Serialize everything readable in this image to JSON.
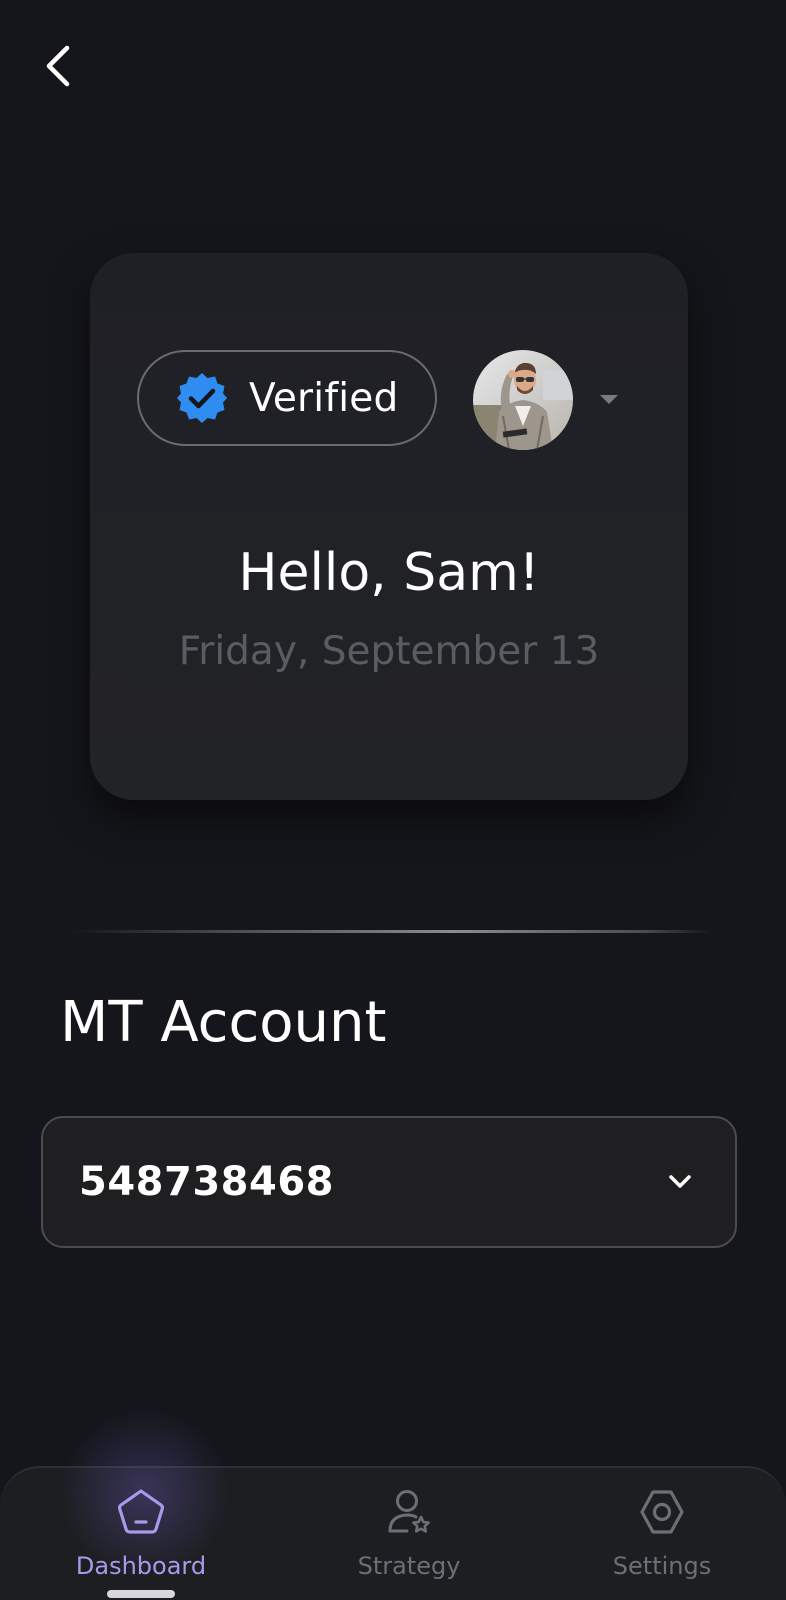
{
  "header": {
    "back_icon": "chevron-left-icon"
  },
  "profile_card": {
    "verified_label": "Verified",
    "verified_icon": "verified-badge-icon",
    "verified_color": "#2f8cf0",
    "avatar_icon": "user-avatar-photo",
    "caret_icon": "caret-down-icon",
    "greeting": "Hello, Sam!",
    "date": "Friday, September 13"
  },
  "mt_account": {
    "title": "MT Account",
    "selected_account": "548738468",
    "chevron_icon": "chevron-down-icon"
  },
  "bottom_nav": {
    "accent_color": "#a79ae8",
    "items": [
      {
        "label": "Dashboard",
        "icon": "home-icon",
        "active": true
      },
      {
        "label": "Strategy",
        "icon": "user-star-icon",
        "active": false
      },
      {
        "label": "Settings",
        "icon": "gear-hexagon-icon",
        "active": false
      }
    ]
  }
}
